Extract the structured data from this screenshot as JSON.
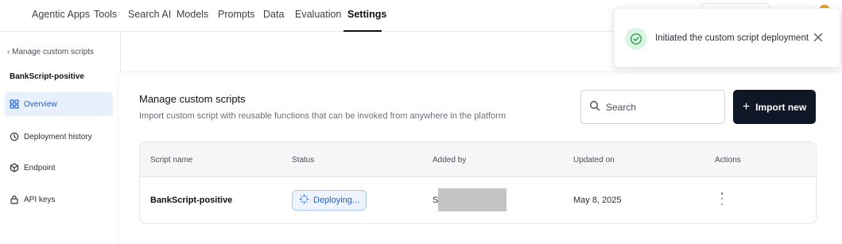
{
  "nav": {
    "tabs": [
      {
        "label": "Agentic Apps"
      },
      {
        "label": "Tools"
      },
      {
        "label": "Search AI"
      },
      {
        "label": "Models"
      },
      {
        "label": "Prompts"
      },
      {
        "label": "Data"
      },
      {
        "label": "Evaluation"
      },
      {
        "label": "Settings",
        "active": true
      }
    ]
  },
  "sidebar": {
    "back_label": "Manage custom scripts",
    "script_title": "BankScript-positive",
    "items": [
      {
        "label": "Overview",
        "icon": "grid-icon",
        "active": true
      },
      {
        "label": "Deployment history",
        "icon": "history-icon"
      },
      {
        "label": "Endpoint",
        "icon": "cube-icon"
      },
      {
        "label": "API keys",
        "icon": "lock-icon"
      }
    ]
  },
  "main": {
    "title": "Manage custom scripts",
    "subtitle": "Import custom script with reusable functions that can be invoked from anywhere in the platform",
    "search_placeholder": "Search",
    "import_label": "Import new",
    "import_plus": "+"
  },
  "table": {
    "columns": [
      "Script name",
      "Status",
      "Added by",
      "Updated on",
      "Actions"
    ],
    "rows": [
      {
        "script_name": "BankScript-positive",
        "status": "Deploying...",
        "added_by_initial": "S",
        "updated_on": "May 8, 2025"
      }
    ]
  },
  "toast": {
    "message": "Initiated the custom script deployment",
    "close_glyph": "✕"
  },
  "colors": {
    "accent": "#1b5fd6",
    "primary_button": "#0f1726",
    "success": "#2e9b4f",
    "avatar": "#f39a1f"
  }
}
